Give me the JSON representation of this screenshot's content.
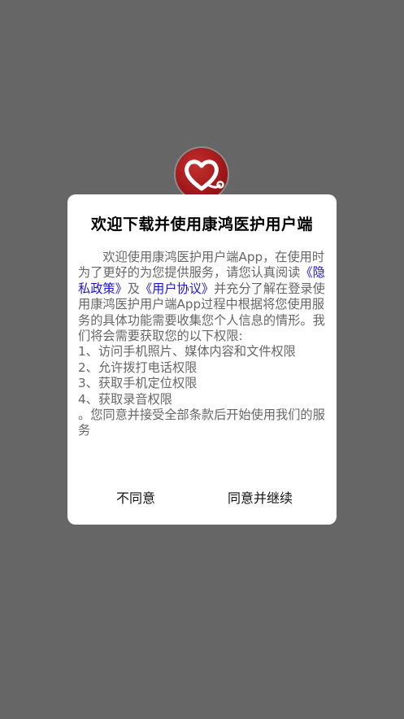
{
  "colors": {
    "backdrop": "#666666",
    "dialog_bg": "#ffffff",
    "link": "#1b14d9",
    "body_text": "#666666",
    "logo_red": "#9d1416"
  },
  "logo": {
    "icon": "heart-stethoscope-icon"
  },
  "dialog": {
    "title": "欢迎下载并使用康鸿医护用户端",
    "intro_pre": "欢迎使用康鸿医护用户端App，在使用时为了更好的为您提供服务，请您认真阅读",
    "privacy_link": "《隐私政策》",
    "and": "及",
    "agreement_link": "《用户协议》",
    "intro_post": "并充分了解在登录使用康鸿医护用户端App过程中根据将您使用服务的具体功能需要收集您个人信息的情形。我们将会需要获取您的以下权限:",
    "permissions": [
      "1、访问手机照片、媒体内容和文件权限",
      "2、允许拨打电话权限",
      "3、获取手机定位权限",
      "4、获取录音权限"
    ],
    "closing": "。您同意并接受全部条款后开始使用我们的服务",
    "disagree_label": "不同意",
    "agree_label": "同意并继续"
  }
}
